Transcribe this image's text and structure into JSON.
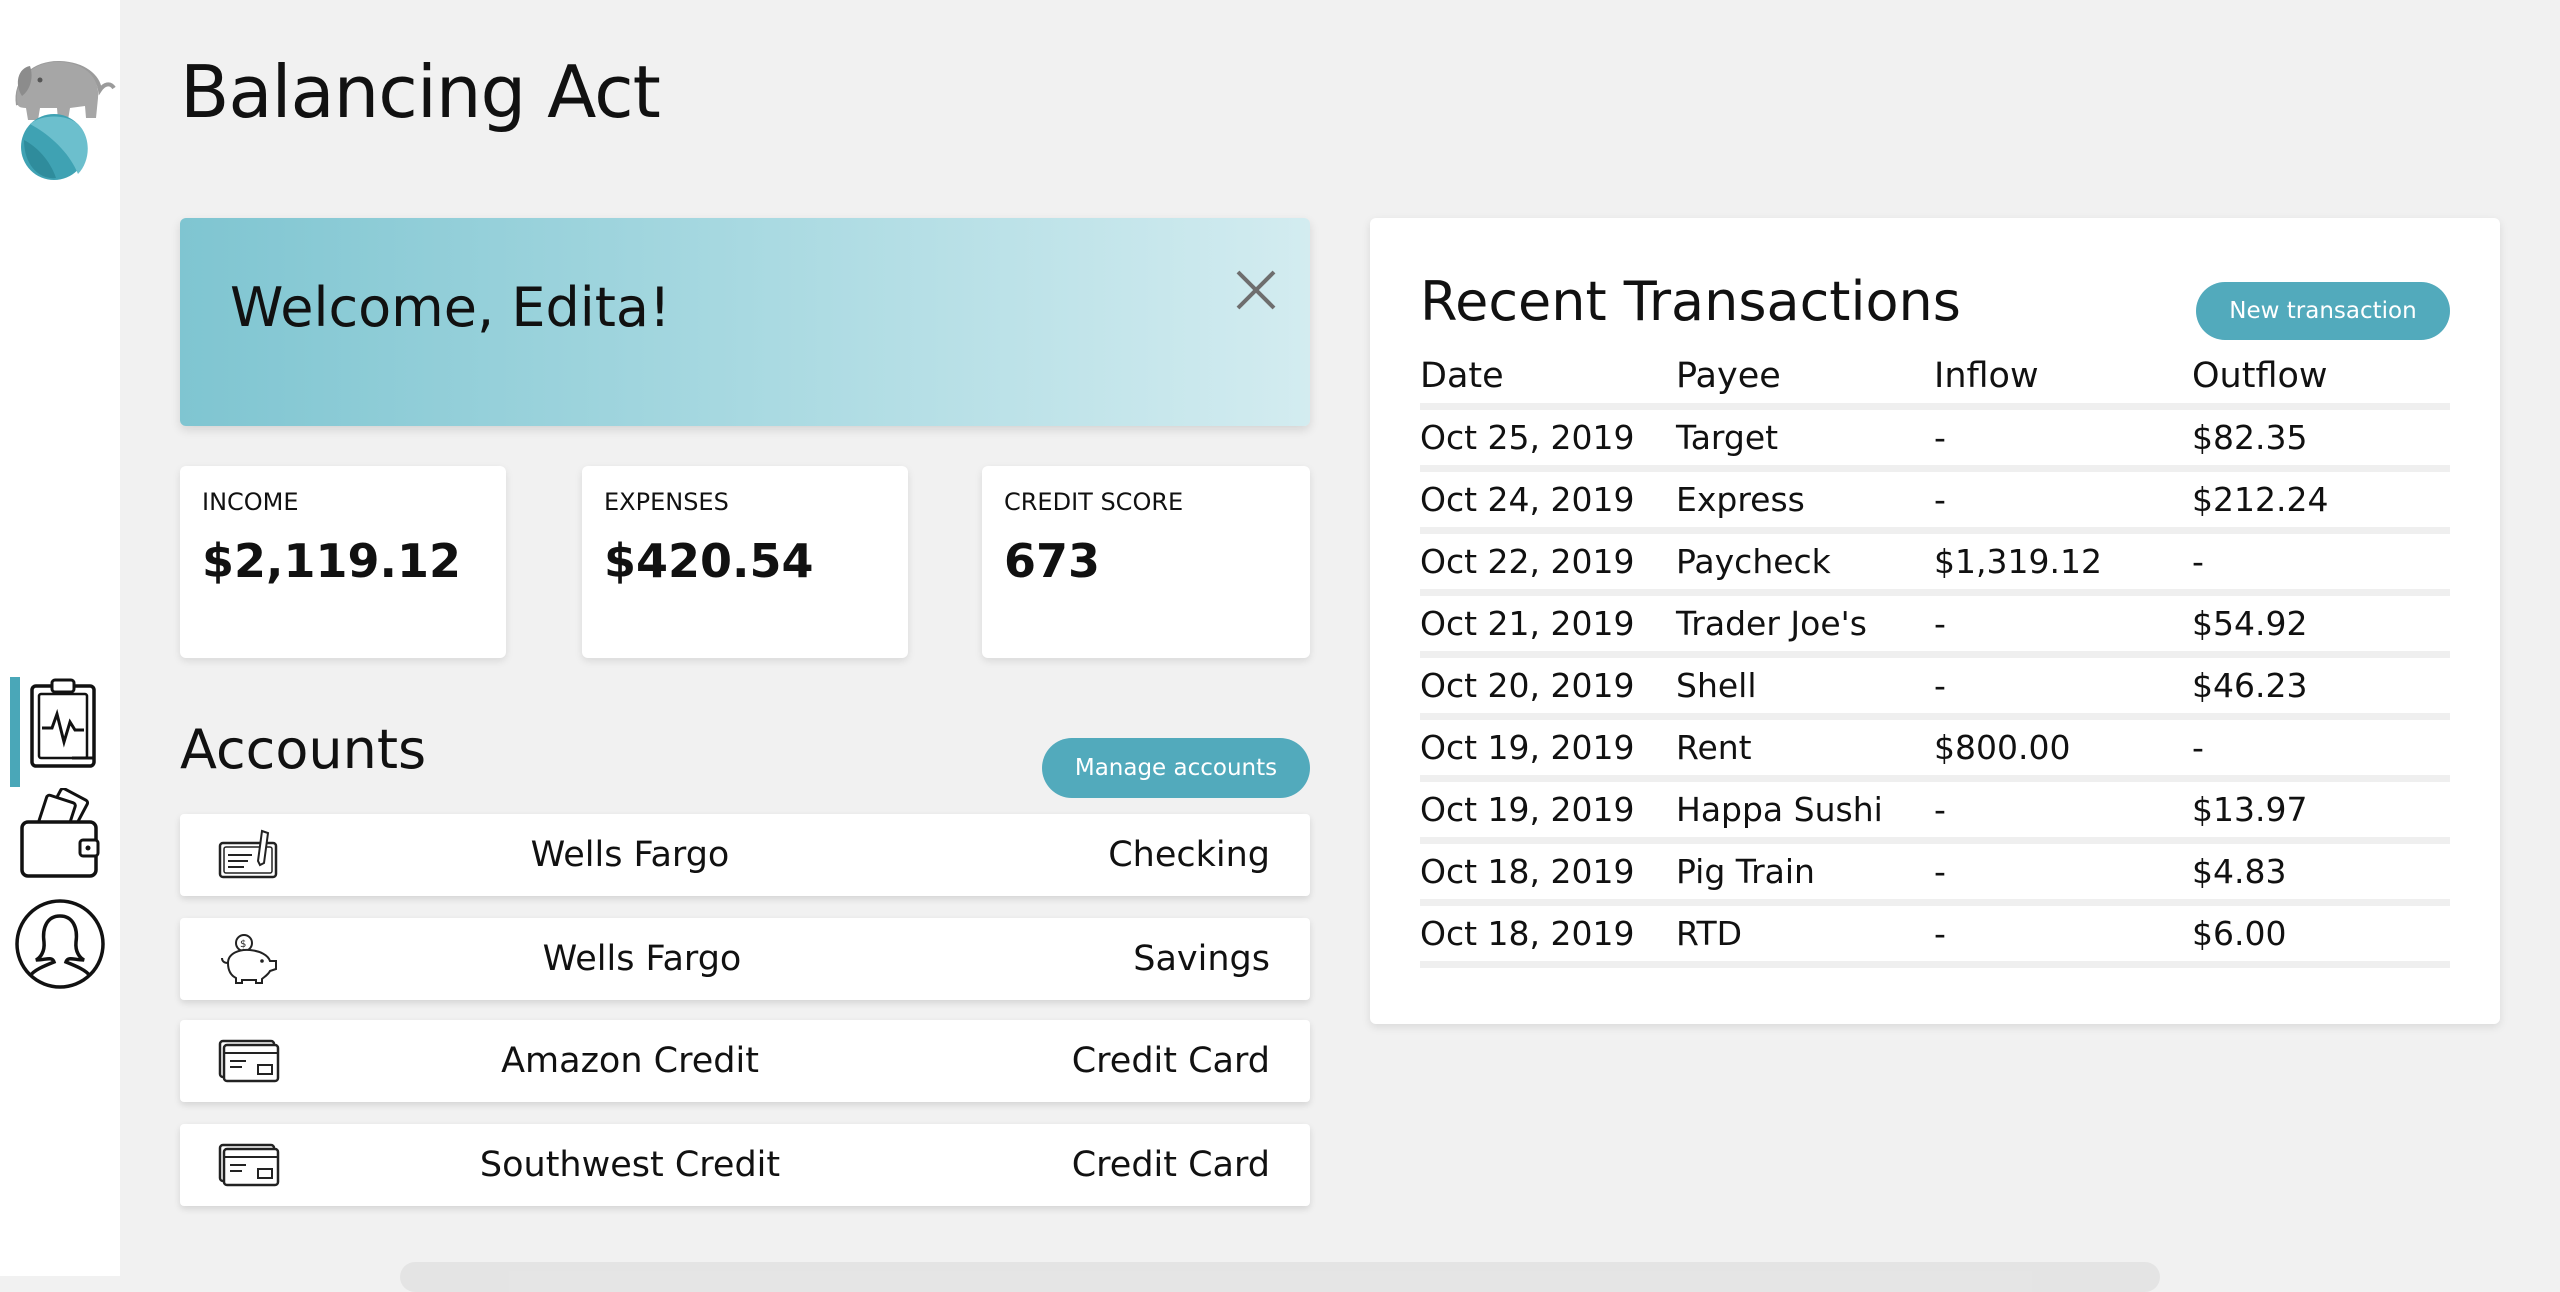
{
  "app": {
    "title": "Balancing Act"
  },
  "welcome": {
    "message": "Welcome, Edita!"
  },
  "stats": [
    {
      "label": "INCOME",
      "value": "$2,119.12"
    },
    {
      "label": "EXPENSES",
      "value": "$420.54"
    },
    {
      "label": "CREDIT SCORE",
      "value": "673"
    }
  ],
  "accounts": {
    "title": "Accounts",
    "manage_label": "Manage accounts",
    "items": [
      {
        "name": "Wells Fargo",
        "type": "Checking",
        "icon": "checkbook-icon"
      },
      {
        "name": "Wells Fargo",
        "type": "Savings",
        "icon": "piggy-bank-icon"
      },
      {
        "name": "Amazon Credit",
        "type": "Credit Card",
        "icon": "credit-card-icon"
      },
      {
        "name": "Southwest Credit",
        "type": "Credit Card",
        "icon": "credit-card-icon"
      }
    ]
  },
  "transactions": {
    "title": "Recent Transactions",
    "new_label": "New transaction",
    "columns": [
      "Date",
      "Payee",
      "Inflow",
      "Outflow"
    ],
    "rows": [
      [
        "Oct 25, 2019",
        "Target",
        "-",
        "$82.35"
      ],
      [
        "Oct 24, 2019",
        "Express",
        "-",
        "$212.24"
      ],
      [
        "Oct 22, 2019",
        "Paycheck",
        "$1,319.12",
        "-"
      ],
      [
        "Oct 21, 2019",
        "Trader Joe's",
        "-",
        "$54.92"
      ],
      [
        "Oct 20, 2019",
        "Shell",
        "-",
        "$46.23"
      ],
      [
        "Oct 19, 2019",
        "Rent",
        "$800.00",
        "-"
      ],
      [
        "Oct 19, 2019",
        "Happa Sushi",
        "-",
        "$13.97"
      ],
      [
        "Oct 18, 2019",
        "Pig Train",
        "-",
        "$4.83"
      ],
      [
        "Oct 18, 2019",
        "RTD",
        "-",
        "$6.00"
      ]
    ]
  },
  "sidebar": {
    "items": [
      {
        "icon": "health-clipboard-icon",
        "active": true
      },
      {
        "icon": "wallet-icon",
        "active": false
      },
      {
        "icon": "user-avatar-icon",
        "active": false
      }
    ]
  },
  "colors": {
    "accent": "#52aabc",
    "background": "#f1f1f1",
    "welcome_start": "#7fc5d1",
    "welcome_end": "#d3ecf0"
  }
}
